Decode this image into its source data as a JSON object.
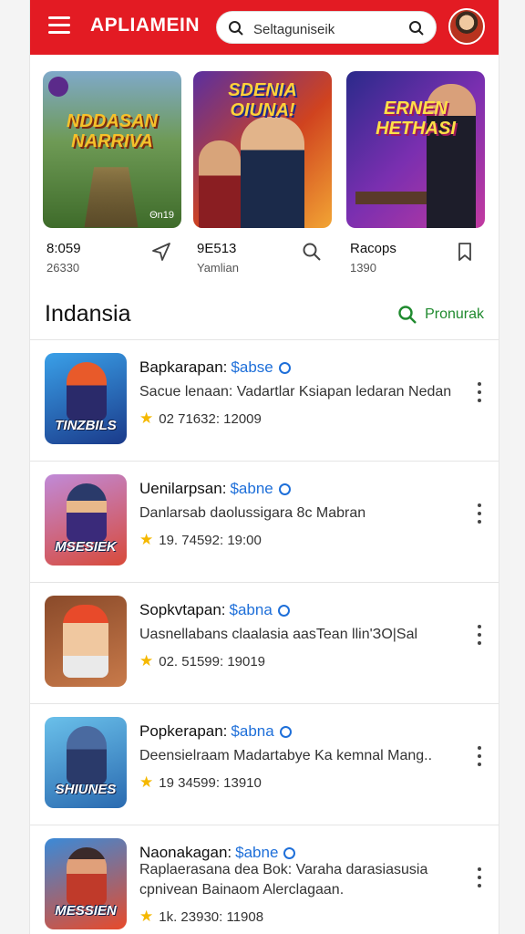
{
  "header": {
    "brand": "APLIAMEIN",
    "search_value": "Seltaguniseik",
    "colors": {
      "accent": "#e31b23",
      "link": "#1e6fd9",
      "green": "#1f8a2e",
      "star": "#f5b800"
    }
  },
  "featured": [
    {
      "banner": "NDDASAN NARRIVA",
      "tag": "Θn19",
      "line1": "8:059",
      "line2": "26330",
      "action_icon": "send-icon"
    },
    {
      "banner": "SDENIA OIUNA!",
      "line1": "9E513",
      "line2": "Yamlian",
      "action_icon": "search-icon"
    },
    {
      "banner": "ERNEN HETHASI",
      "line1": "Racops",
      "line2": "1390",
      "action_icon": "bookmark-icon"
    }
  ],
  "section": {
    "title": "Indansia",
    "action_label": "Pronurak"
  },
  "apps": [
    {
      "title": "Bapkarapan:",
      "tag": "$abse",
      "desc": "Sacue lenaan: Vadartlar Ksiapan ledaran Nedan",
      "stats": "02  71632: 12009",
      "icon_label": "TINZBILS"
    },
    {
      "title": "Uenilarpsan:",
      "tag": "$abne",
      "desc": "Danlarsab daolussigara 8c Mabran",
      "stats": "19.  74592: 19:00",
      "icon_label": "MSESIEK"
    },
    {
      "title": "Sopkvtapan:",
      "tag": "$abna",
      "desc": "Uasnellabans claalasia aasTean llin'ЗO|Sal",
      "stats": "02.  51599: 19019",
      "icon_label": ""
    },
    {
      "title": "Popkerapan:",
      "tag": "$abna",
      "desc": "Deensielraam Madartabye Ka kemnal Mang..",
      "stats": "19  34599: 13910",
      "icon_label": "SHIUNES"
    },
    {
      "title": "Naonakagan:",
      "tag": "$abne",
      "desc": "Raplaerasana dea Bok: Varaha darasiasusia cpnivean Bainaom Alerclagaan.",
      "stats": "1k.  23930: 11908",
      "icon_label": "MESSIEN"
    }
  ]
}
